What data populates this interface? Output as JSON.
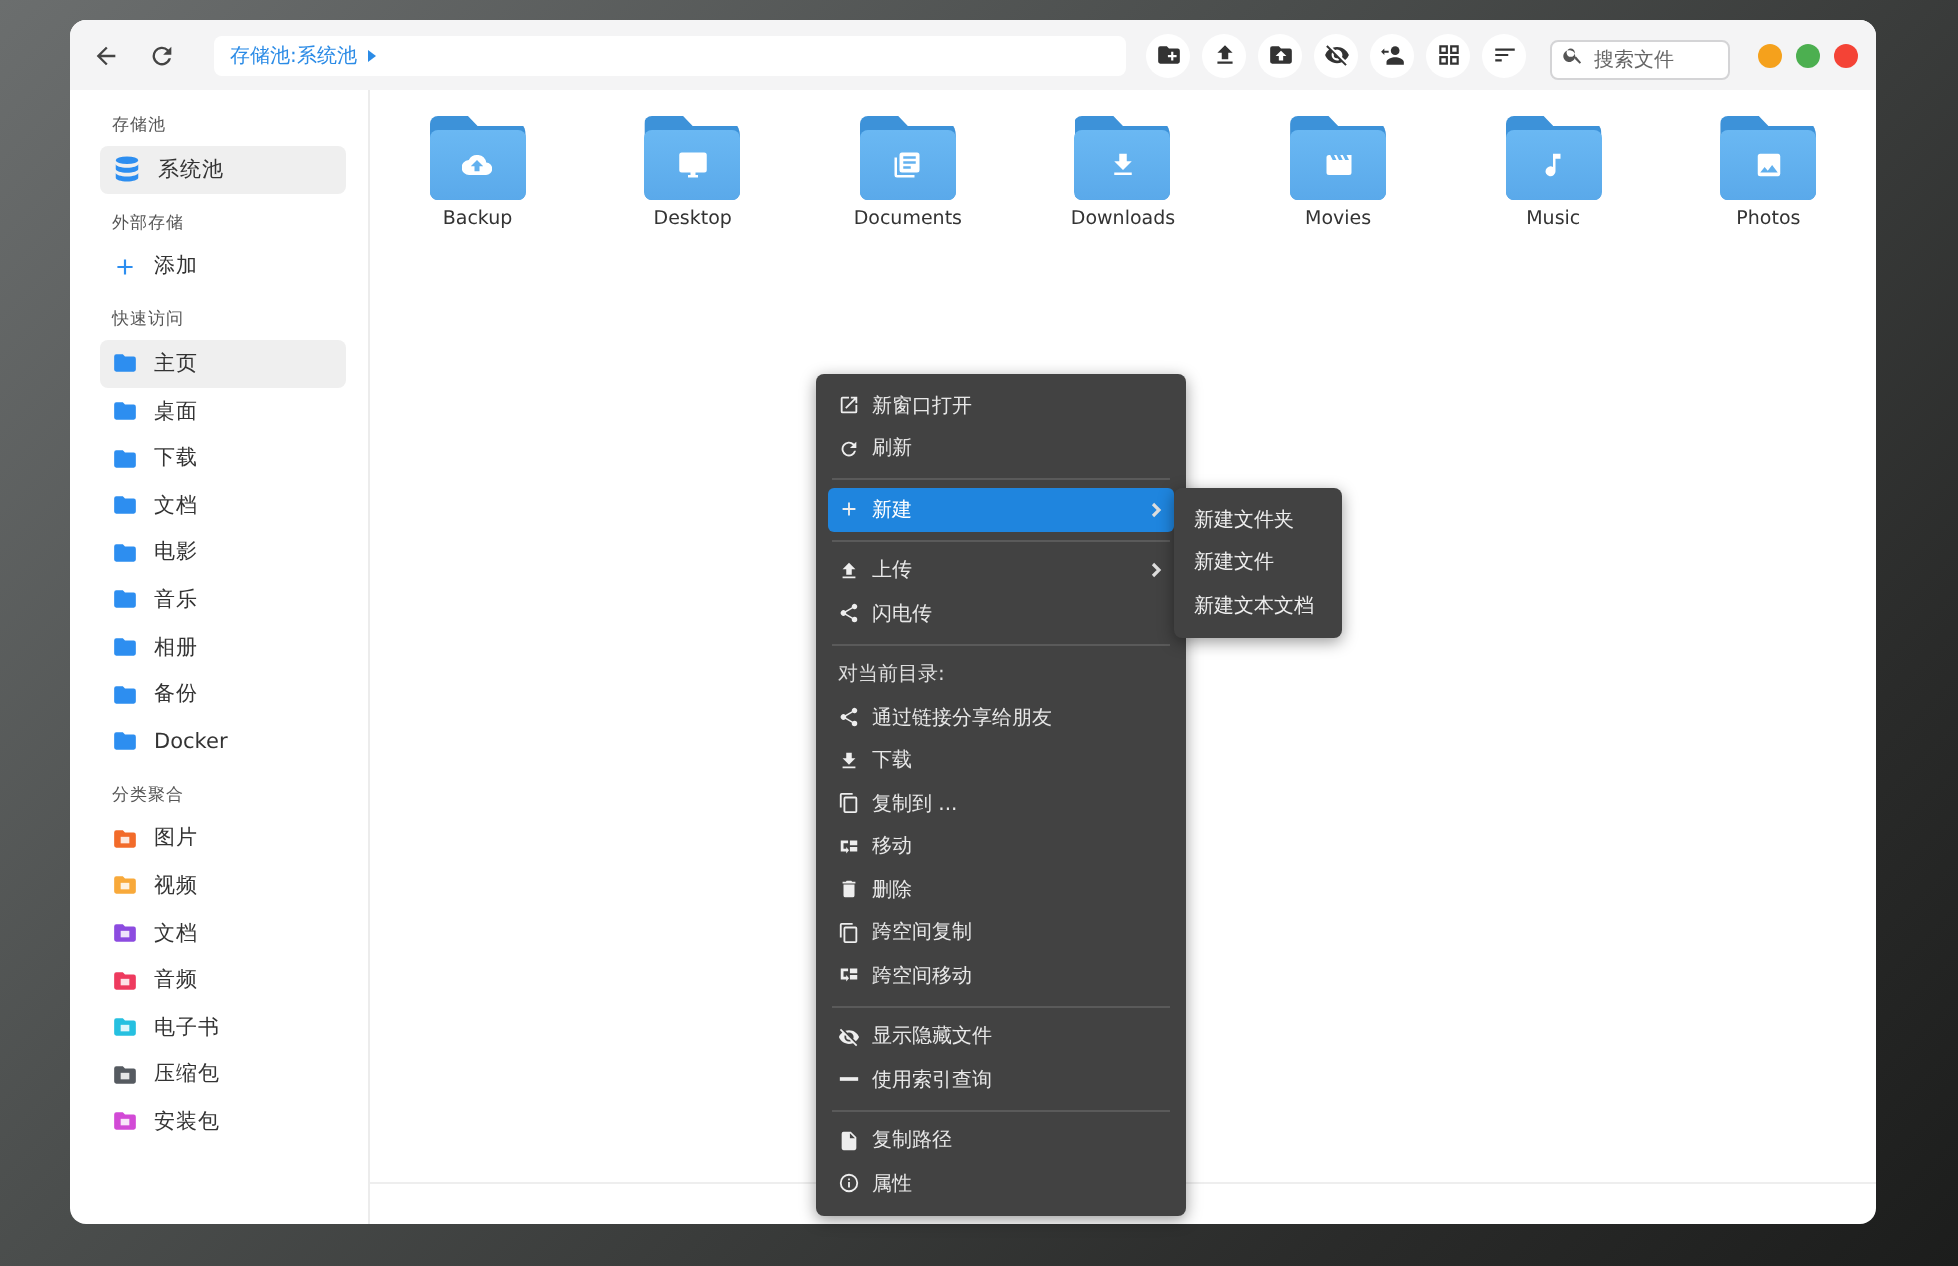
{
  "toolbar": {
    "breadcrumb": {
      "path": "存储池:系统池"
    },
    "search": {
      "placeholder": "搜索文件"
    },
    "window_controls": [
      {
        "color": "#f5a11c"
      },
      {
        "color": "#4caf50"
      },
      {
        "color": "#f44336"
      }
    ]
  },
  "sidebar": {
    "sections": [
      {
        "title": "存储池",
        "items": [
          {
            "label": "系统池",
            "kind": "pool",
            "selected": true
          }
        ]
      },
      {
        "title": "外部存储",
        "items": [
          {
            "label": "添加",
            "kind": "add",
            "selected": false
          }
        ]
      },
      {
        "title": "快速访问",
        "items": [
          {
            "label": "主页",
            "kind": "folder",
            "selected": true
          },
          {
            "label": "桌面",
            "kind": "folder",
            "selected": false
          },
          {
            "label": "下载",
            "kind": "folder",
            "selected": false
          },
          {
            "label": "文档",
            "kind": "folder",
            "selected": false
          },
          {
            "label": "电影",
            "kind": "folder",
            "selected": false
          },
          {
            "label": "音乐",
            "kind": "folder",
            "selected": false
          },
          {
            "label": "相册",
            "kind": "folder",
            "selected": false
          },
          {
            "label": "备份",
            "kind": "folder",
            "selected": false
          },
          {
            "label": "Docker",
            "kind": "folder",
            "selected": false
          }
        ]
      },
      {
        "title": "分类聚合",
        "items": [
          {
            "label": "图片",
            "kind": "category",
            "color": "#f26b2a",
            "selected": false
          },
          {
            "label": "视频",
            "kind": "category",
            "color": "#f8a93a",
            "selected": false
          },
          {
            "label": "文档",
            "kind": "category",
            "color": "#8c4be0",
            "selected": false
          },
          {
            "label": "音频",
            "kind": "category",
            "color": "#ee3a5e",
            "selected": false
          },
          {
            "label": "电子书",
            "kind": "category",
            "color": "#26c0e0",
            "selected": false
          },
          {
            "label": "压缩包",
            "kind": "category",
            "color": "#555a60",
            "selected": false
          },
          {
            "label": "安装包",
            "kind": "category",
            "color": "#d24ad6",
            "selected": false
          }
        ]
      }
    ]
  },
  "folders": [
    {
      "name": "Backup",
      "kind": "backup"
    },
    {
      "name": "Desktop",
      "kind": "desktop"
    },
    {
      "name": "Documents",
      "kind": "documents"
    },
    {
      "name": "Downloads",
      "kind": "downloads"
    },
    {
      "name": "Movies",
      "kind": "movies"
    },
    {
      "name": "Music",
      "kind": "music"
    },
    {
      "name": "Photos",
      "kind": "photos"
    }
  ],
  "context_menu": {
    "items": [
      {
        "kind": "open",
        "label": "新窗口打开",
        "submenu": false,
        "selected": false
      },
      {
        "kind": "refresh",
        "label": "刷新",
        "submenu": false,
        "selected": false
      },
      {
        "kind": "divider"
      },
      {
        "kind": "new",
        "label": "新建",
        "submenu": true,
        "selected": true
      },
      {
        "kind": "divider"
      },
      {
        "kind": "upload",
        "label": "上传",
        "submenu": true,
        "selected": false
      },
      {
        "kind": "share",
        "label": "闪电传",
        "submenu": false,
        "selected": false
      },
      {
        "kind": "divider"
      },
      {
        "kind": "heading",
        "label": "对当前目录:"
      },
      {
        "kind": "share",
        "label": "通过链接分享给朋友",
        "submenu": false,
        "selected": false
      },
      {
        "kind": "download",
        "label": "下载",
        "submenu": false,
        "selected": false
      },
      {
        "kind": "copy",
        "label": "复制到 ...",
        "submenu": false,
        "selected": false
      },
      {
        "kind": "move",
        "label": "移动",
        "submenu": false,
        "selected": false
      },
      {
        "kind": "delete",
        "label": "删除",
        "submenu": false,
        "selected": false
      },
      {
        "kind": "copy",
        "label": "跨空间复制",
        "submenu": false,
        "selected": false
      },
      {
        "kind": "move",
        "label": "跨空间移动",
        "submenu": false,
        "selected": false
      },
      {
        "kind": "divider"
      },
      {
        "kind": "hidden",
        "label": "显示隐藏文件",
        "submenu": false,
        "selected": false
      },
      {
        "kind": "index",
        "label": "使用索引查询",
        "submenu": false,
        "selected": false
      },
      {
        "kind": "divider"
      },
      {
        "kind": "path",
        "label": "复制路径",
        "submenu": false,
        "selected": false
      },
      {
        "kind": "properties",
        "label": "属性",
        "submenu": false,
        "selected": false
      }
    ],
    "submenu": [
      {
        "label": "新建文件夹"
      },
      {
        "label": "新建文件"
      },
      {
        "label": "新建文本文档"
      }
    ]
  }
}
